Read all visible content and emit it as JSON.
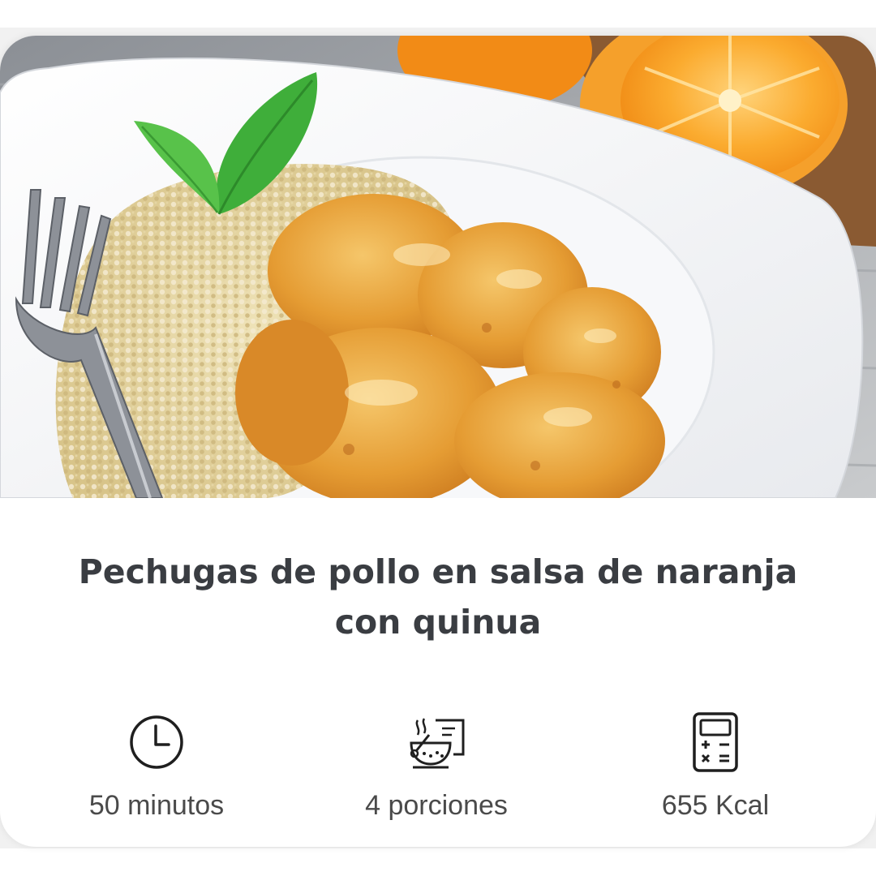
{
  "recipe": {
    "image": {
      "alt": "Pechugas de pollo en salsa de naranja con quinua",
      "icon": "food-photo"
    },
    "title": "Pechugas de pollo en salsa de naranja con quinua",
    "stats": [
      {
        "icon": "clock-icon",
        "label": "50 minutos"
      },
      {
        "icon": "bowl-icon",
        "label": "4 porciones"
      },
      {
        "icon": "calculator-icon",
        "label": "655 Kcal"
      }
    ]
  },
  "colors": {
    "title": "#3a3d42",
    "text": "#4a4a4a",
    "sauce": "#e39a2d",
    "orange": "#f7921e"
  }
}
